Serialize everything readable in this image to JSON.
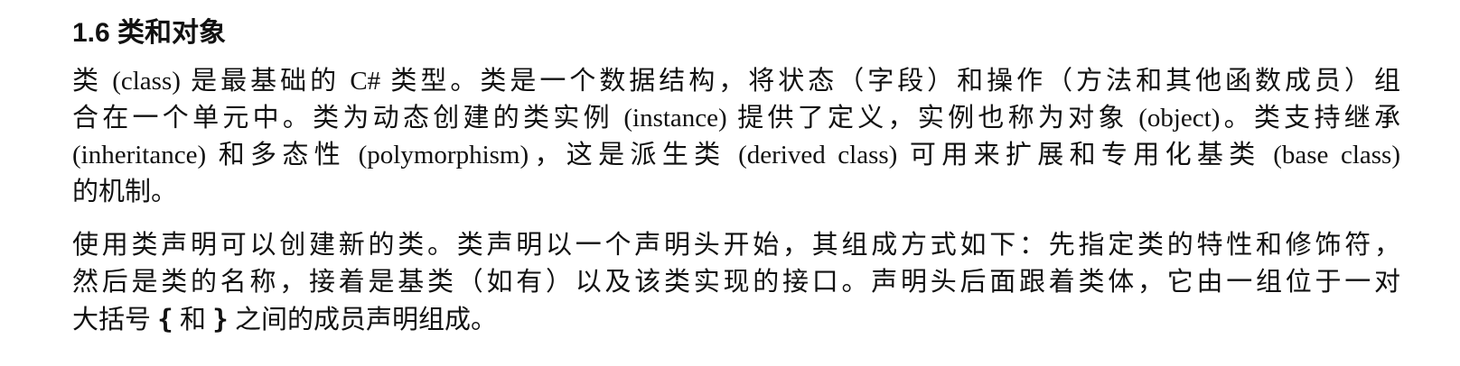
{
  "section": {
    "heading": "1.6 类和对象"
  },
  "paragraph_1": {
    "lines": [
      "类 (class) 是最基础的 C# 类型。类是一个数据结构，将状态（字段）和操作（方法和其他函数成员）组",
      "合在一个单元中。类为动态创建的类实例 (instance) 提供了定义，实例也称为对象 (object)。类支持继承",
      "(inheritance) 和多态性 (polymorphism)，这是派生类 (derived class) 可用来扩展和专用化基类 (base class)",
      "的机制。"
    ]
  },
  "paragraph_2": {
    "lines": [
      "使用类声明可以创建新的类。类声明以一个声明头开始，其组成方式如下：先指定类的特性和修饰符，",
      "然后是类的名称，接着是基类（如有）以及该类实现的接口。声明头后面跟着类体，它由一组位于一对"
    ],
    "last_line": {
      "prefix": "大括号",
      "open_brace": "{",
      "middle": "和",
      "close_brace": "}",
      "suffix": "之间的成员声明组成。"
    }
  }
}
